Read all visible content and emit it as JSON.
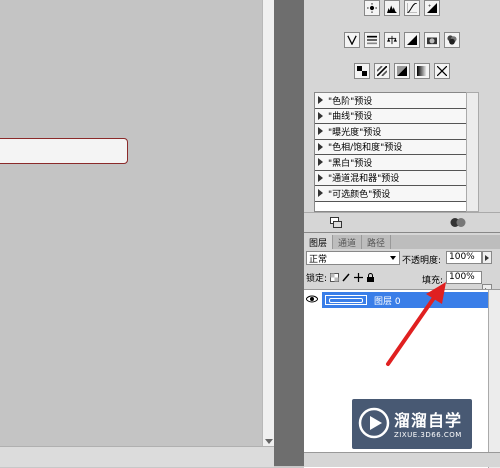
{
  "adjustments": {
    "tool_icons_row1": [
      "brightness-icon",
      "levels-icon",
      "curves-icon",
      "exposure-icon"
    ],
    "tool_icons_row2": [
      "vibrance-icon",
      "hue-saturation-icon",
      "color-balance-icon",
      "black-white-icon",
      "photo-filter-icon",
      "channel-mixer-icon"
    ],
    "tool_icons_row3": [
      "invert-icon",
      "posterize-icon",
      "threshold-icon",
      "gradient-map-icon",
      "selective-color-icon"
    ],
    "presets": [
      "\"色阶\"预设",
      "\"曲线\"预设",
      "\"曝光度\"预设",
      "\"色相/饱和度\"预设",
      "\"黑白\"预设",
      "\"通道混和器\"预设",
      "\"可选颜色\"预设"
    ]
  },
  "layers": {
    "tabs": [
      "图层",
      "通道",
      "路径"
    ],
    "blend_mode": "正常",
    "opacity_label": "不透明度:",
    "opacity_value": "100%",
    "lock_label": "锁定:",
    "fill_label": "填充:",
    "fill_value": "100%",
    "layer_name": "图层 0"
  },
  "watermark": {
    "title": "溜溜自学",
    "subtitle": "ZIXUE.3D66.COM"
  },
  "colors": {
    "selected_layer": "#3a7ee8",
    "annotation_arrow": "#e02020"
  }
}
